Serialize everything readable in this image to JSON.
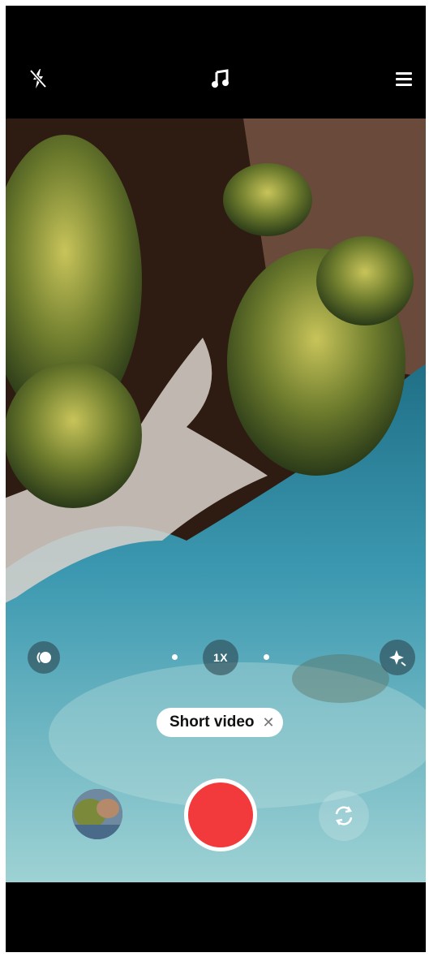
{
  "top_bar": {
    "flash_icon": "flash-off-icon",
    "music_icon": "music-note-icon",
    "menu_icon": "hamburger-menu-icon"
  },
  "controls": {
    "filter_icon": "filter-toggle-icon",
    "zoom_label": "1X",
    "effects_icon": "sparkle-effects-icon"
  },
  "mode": {
    "label": "Short video",
    "close_symbol": "✕"
  },
  "shutter": {
    "color": "#f23a3c",
    "state": "record"
  },
  "gallery": {
    "icon": "gallery-thumbnail"
  },
  "switch_camera": {
    "icon": "switch-camera-icon"
  }
}
